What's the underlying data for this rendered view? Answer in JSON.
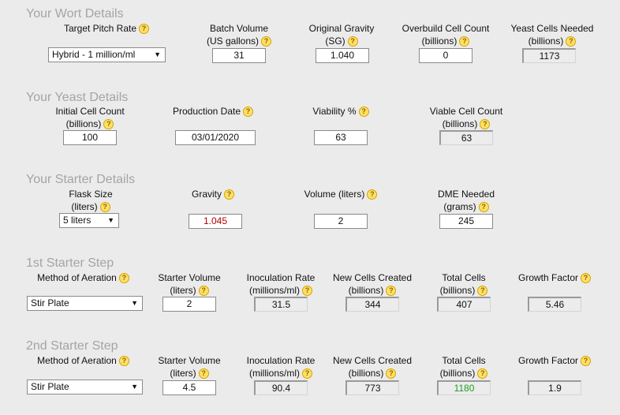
{
  "wort": {
    "title": "Your Wort Details",
    "pitch_rate_label": "Target Pitch Rate",
    "pitch_rate_value": "Hybrid - 1 million/ml",
    "batch_volume_label1": "Batch Volume",
    "batch_volume_label2": "(US gallons)",
    "batch_volume_value": "31",
    "og_label1": "Original Gravity",
    "og_label2": "(SG)",
    "og_value": "1.040",
    "overbuild_label1": "Overbuild Cell Count",
    "overbuild_label2": "(billions)",
    "overbuild_value": "0",
    "needed_label1": "Yeast Cells Needed",
    "needed_label2": "(billions)",
    "needed_value": "1173"
  },
  "yeast": {
    "title": "Your Yeast Details",
    "initial_label1": "Initial Cell Count",
    "initial_label2": "(billions)",
    "initial_value": "100",
    "date_label": "Production Date",
    "date_value": "03/01/2020",
    "viability_label": "Viability %",
    "viability_value": "63",
    "viable_label1": "Viable Cell Count",
    "viable_label2": "(billions)",
    "viable_value": "63"
  },
  "starter": {
    "title": "Your Starter Details",
    "flask_label1": "Flask Size",
    "flask_label2": "(liters)",
    "flask_value": "5 liters",
    "gravity_label": "Gravity",
    "gravity_value": "1.045",
    "volume_label": "Volume (liters)",
    "volume_value": "2",
    "dme_label1": "DME Needed",
    "dme_label2": "(grams)",
    "dme_value": "245"
  },
  "steps": [
    {
      "title": "1st Starter Step",
      "aeration_label": "Method of Aeration",
      "aeration_value": "Stir Plate",
      "volume_label1": "Starter Volume",
      "volume_label2": "(liters)",
      "volume_value": "2",
      "inoc_label1": "Inoculation Rate",
      "inoc_label2": "(millions/ml)",
      "inoc_value": "31.5",
      "new_label1": "New Cells Created",
      "new_label2": "(billions)",
      "new_value": "344",
      "total_label1": "Total Cells",
      "total_label2": "(billions)",
      "total_value": "407",
      "growth_label": "Growth Factor",
      "growth_value": "5.46"
    },
    {
      "title": "2nd Starter Step",
      "aeration_label": "Method of Aeration",
      "aeration_value": "Stir Plate",
      "volume_label1": "Starter Volume",
      "volume_label2": "(liters)",
      "volume_value": "4.5",
      "inoc_label1": "Inoculation Rate",
      "inoc_label2": "(millions/ml)",
      "inoc_value": "90.4",
      "new_label1": "New Cells Created",
      "new_label2": "(billions)",
      "new_value": "773",
      "total_label1": "Total Cells",
      "total_label2": "(billions)",
      "total_value": "1180",
      "growth_label": "Growth Factor",
      "growth_value": "1.9"
    }
  ],
  "icons": {
    "help": "help-question-icon",
    "dropdown": "dropdown-arrow-icon"
  },
  "colors": {
    "gravity_value": "#b40000",
    "total_cells_ok": "#1e9e1e"
  }
}
